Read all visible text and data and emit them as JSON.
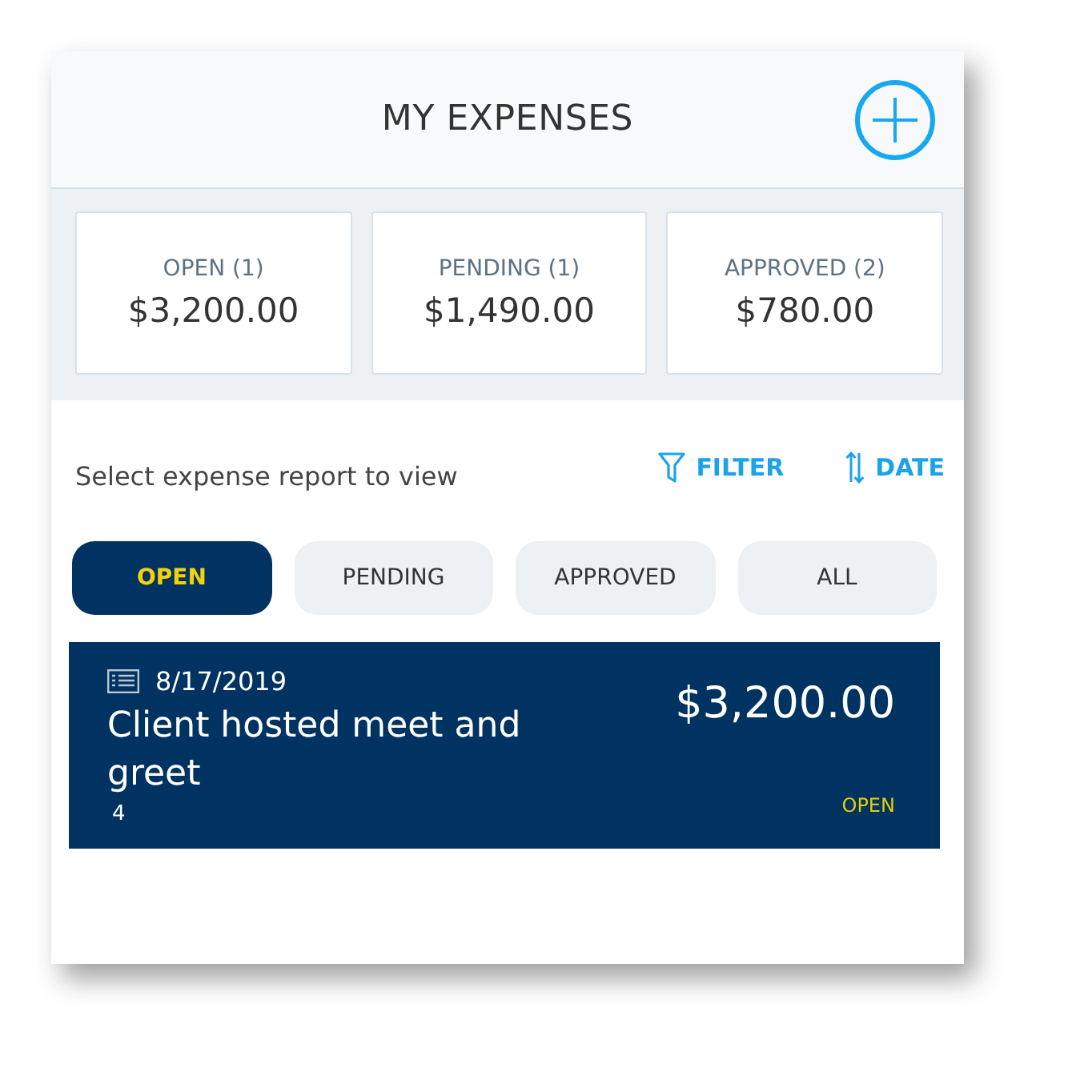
{
  "header": {
    "title": "MY EXPENSES"
  },
  "summary": [
    {
      "label": "OPEN (1)",
      "amount": "$3,200.00"
    },
    {
      "label": "PENDING (1)",
      "amount": "$1,490.00"
    },
    {
      "label": "APPROVED (2)",
      "amount": "$780.00"
    }
  ],
  "toolbar": {
    "prompt": "Select expense report to view",
    "actions": [
      {
        "kind": "filter",
        "label": "FILTER"
      },
      {
        "kind": "sort",
        "label": "DATE"
      }
    ]
  },
  "tabs": [
    {
      "label": "OPEN",
      "selected": true
    },
    {
      "label": "PENDING",
      "selected": false
    },
    {
      "label": "APPROVED",
      "selected": false
    },
    {
      "label": "ALL",
      "selected": false
    }
  ],
  "reports": [
    {
      "date": "8/17/2019",
      "title": "Client hosted meet and greet",
      "count": "4",
      "amount": "$3,200.00",
      "status": "OPEN"
    }
  ]
}
